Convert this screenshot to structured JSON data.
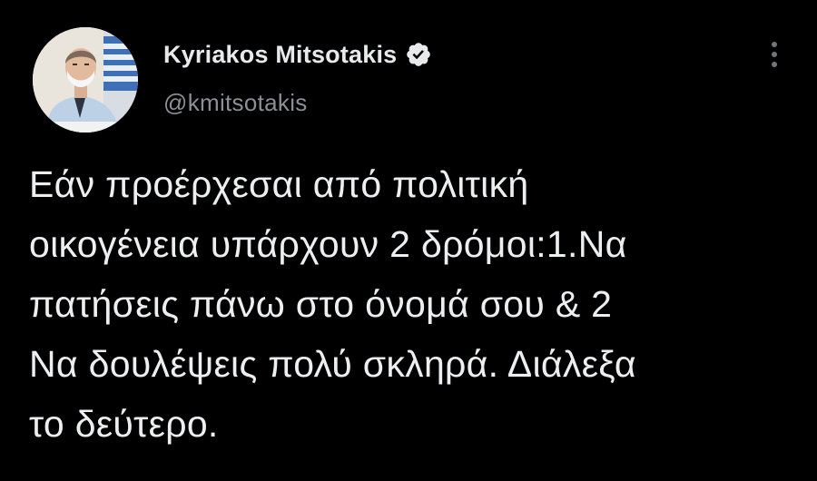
{
  "tweet": {
    "author": {
      "display_name": "Kyriakos Mitsotakis",
      "handle": "@kmitsotakis",
      "verified": true,
      "verified_icon": "verified-badge-icon",
      "avatar_icon": "profile-photo"
    },
    "menu_icon": "more-options-icon",
    "text_lines": [
      "Εάν προέρχεσαι από πολιτική",
      "οικογένεια υπάρχουν 2 δρόμοι:1.Να",
      "πατήσεις πάνω στο όνομά σου & 2",
      "Να δουλέψεις πολύ σκληρά. Διάλεξα",
      "το δεύτερο."
    ]
  },
  "colors": {
    "background": "#000000",
    "text": "#e7e9ea",
    "secondary_text": "#8b9096",
    "verified_fill": "#e7e9ea"
  }
}
